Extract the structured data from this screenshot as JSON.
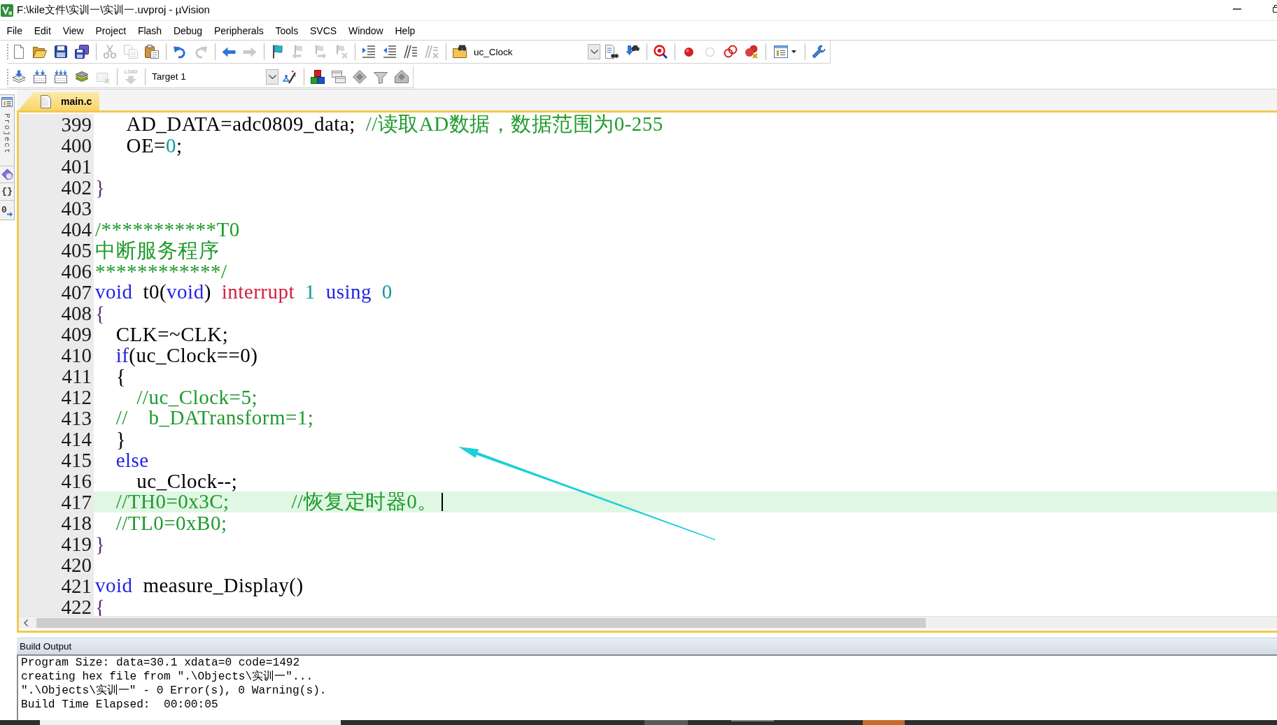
{
  "window": {
    "title": "F:\\kile文件\\实训一\\实训一.uvproj - µVision"
  },
  "menu": [
    "File",
    "Edit",
    "View",
    "Project",
    "Flash",
    "Debug",
    "Peripherals",
    "Tools",
    "SVCS",
    "Window",
    "Help"
  ],
  "toolbar_1": [
    {
      "kind": "button",
      "disabled": false
    },
    {
      "kind": "button",
      "disabled": false
    },
    {
      "kind": "button",
      "disabled": false
    },
    {
      "kind": "button",
      "disabled": false
    },
    {
      "kind": "separator"
    },
    {
      "kind": "button",
      "disabled": true
    },
    {
      "kind": "button",
      "disabled": true
    },
    {
      "kind": "button",
      "disabled": false
    },
    {
      "kind": "separator"
    },
    {
      "kind": "button",
      "disabled": false
    },
    {
      "kind": "button",
      "disabled": true
    },
    {
      "kind": "separator"
    },
    {
      "kind": "button",
      "disabled": false
    },
    {
      "kind": "button",
      "disabled": true
    },
    {
      "kind": "separator"
    },
    {
      "kind": "button",
      "disabled": false
    },
    {
      "kind": "button",
      "disabled": true
    },
    {
      "kind": "button",
      "disabled": true
    },
    {
      "kind": "button",
      "disabled": true
    },
    {
      "kind": "separator"
    },
    {
      "kind": "button",
      "disabled": false
    },
    {
      "kind": "button",
      "disabled": false
    },
    {
      "kind": "button",
      "disabled": false
    },
    {
      "kind": "button",
      "disabled": true
    },
    {
      "kind": "separator"
    },
    {
      "kind": "button",
      "disabled": false
    },
    {
      "kind": "combo",
      "value": "uc_Clock"
    },
    {
      "kind": "button",
      "disabled": false
    },
    {
      "kind": "button",
      "disabled": false
    },
    {
      "kind": "separator"
    },
    {
      "kind": "button",
      "disabled": false
    },
    {
      "kind": "separator"
    },
    {
      "kind": "button",
      "disabled": false
    },
    {
      "kind": "button",
      "disabled": true
    },
    {
      "kind": "button",
      "disabled": false
    },
    {
      "kind": "button",
      "disabled": false
    },
    {
      "kind": "separator"
    },
    {
      "kind": "button",
      "disabled": false
    },
    {
      "kind": "separator"
    },
    {
      "kind": "button",
      "disabled": false
    }
  ],
  "toolbar_2": [
    {
      "kind": "button",
      "disabled": false
    },
    {
      "kind": "button",
      "disabled": false
    },
    {
      "kind": "button",
      "disabled": false
    },
    {
      "kind": "button",
      "disabled": false
    },
    {
      "kind": "button",
      "disabled": true
    },
    {
      "kind": "separator"
    },
    {
      "kind": "button",
      "disabled": true,
      "label": "LOAD"
    },
    {
      "kind": "separator"
    },
    {
      "kind": "combo",
      "value": "Target 1"
    },
    {
      "kind": "button",
      "disabled": false
    },
    {
      "kind": "separator"
    },
    {
      "kind": "button",
      "disabled": false
    },
    {
      "kind": "button",
      "disabled": false
    },
    {
      "kind": "button",
      "disabled": false
    },
    {
      "kind": "button",
      "disabled": false
    },
    {
      "kind": "button",
      "disabled": false
    }
  ],
  "sidebar": {
    "project_tab": "Project",
    "functions_tab": "{}",
    "templates_tab": "0"
  },
  "editor_tabs": [
    {
      "label": "main.c",
      "selected": true
    }
  ],
  "code_lines": [
    {
      "number": "399",
      "current": false,
      "tokens": [
        {
          "kind": "plain",
          "text": "   AD_DATA=adc0809_data; "
        },
        {
          "kind": "comment",
          "text": "//读取AD数据，数据范围为0-255"
        }
      ]
    },
    {
      "number": "400",
      "current": false,
      "tokens": [
        {
          "kind": "plain",
          "text": "   OE="
        },
        {
          "kind": "number",
          "text": "0"
        },
        {
          "kind": "plain",
          "text": ";"
        }
      ]
    },
    {
      "number": "401",
      "current": false
    },
    {
      "number": "402",
      "current": false,
      "tokens": [
        {
          "kind": "brace",
          "text": "}"
        }
      ]
    },
    {
      "number": "403",
      "current": false
    },
    {
      "number": "404",
      "current": false,
      "tokens": [
        {
          "kind": "comment",
          "text": "/***********T0"
        }
      ]
    },
    {
      "number": "405",
      "current": false,
      "tokens": [
        {
          "kind": "comment",
          "text": "中断服务程序"
        }
      ]
    },
    {
      "number": "406",
      "current": false,
      "tokens": [
        {
          "kind": "comment",
          "text": "************/"
        }
      ]
    },
    {
      "number": "407",
      "current": false,
      "tokens": [
        {
          "kind": "keyword",
          "text": "void"
        },
        {
          "kind": "plain",
          "text": " t0("
        },
        {
          "kind": "keyword",
          "text": "void"
        },
        {
          "kind": "plain",
          "text": ") "
        },
        {
          "kind": "special",
          "text": "interrupt"
        },
        {
          "kind": "number",
          "text": " 1"
        },
        {
          "kind": "keyword",
          "text": " using"
        },
        {
          "kind": "number",
          "text": " 0"
        }
      ]
    },
    {
      "number": "408",
      "current": false,
      "tokens": [
        {
          "kind": "brace",
          "text": "{"
        }
      ]
    },
    {
      "number": "409",
      "current": false,
      "tokens": [
        {
          "kind": "plain",
          "text": "  CLK=~CLK;"
        }
      ]
    },
    {
      "number": "410",
      "current": false,
      "tokens": [
        {
          "kind": "keyword",
          "text": "  if"
        },
        {
          "kind": "plain",
          "text": "(uc_Clock==0)"
        }
      ]
    },
    {
      "number": "411",
      "current": false,
      "tokens": [
        {
          "kind": "plain",
          "text": "  {"
        }
      ]
    },
    {
      "number": "412",
      "current": false,
      "tokens": [
        {
          "kind": "comment",
          "text": "    //uc_Clock=5;"
        }
      ]
    },
    {
      "number": "413",
      "current": false,
      "tokens": [
        {
          "kind": "comment",
          "text": "  //  b_DATransform=1;"
        }
      ]
    },
    {
      "number": "414",
      "current": false,
      "tokens": [
        {
          "kind": "plain",
          "text": "  }"
        }
      ]
    },
    {
      "number": "415",
      "current": false,
      "tokens": [
        {
          "kind": "keyword",
          "text": "  else"
        }
      ]
    },
    {
      "number": "416",
      "current": false,
      "tokens": [
        {
          "kind": "plain",
          "text": "    uc_Clock--;"
        }
      ]
    },
    {
      "number": "417",
      "current": true,
      "tokens": [
        {
          "kind": "comment",
          "text": "  //TH0=0x3C;      //恢复定时器0。"
        }
      ]
    },
    {
      "number": "418",
      "current": false,
      "tokens": [
        {
          "kind": "comment",
          "text": "  //TL0=0xB0;"
        }
      ]
    },
    {
      "number": "419",
      "current": false,
      "tokens": [
        {
          "kind": "brace",
          "text": "}"
        }
      ]
    },
    {
      "number": "420",
      "current": false
    },
    {
      "number": "421",
      "current": false,
      "tokens": [
        {
          "kind": "keyword",
          "text": "void"
        },
        {
          "kind": "plain",
          "text": " measure_Display()"
        }
      ]
    },
    {
      "number": "422",
      "current": false,
      "tokens": [
        {
          "kind": "brace",
          "text": "{"
        }
      ]
    }
  ],
  "build_output": {
    "title": "Build Output",
    "lines": [
      "Program Size: data=30.1 xdata=0 code=1492",
      "creating hex file from \".\\Objects\\实训一\"...",
      "\".\\Objects\\实训一\" - 0 Error(s), 0 Warning(s).",
      "Build Time Elapsed:  00:00:05"
    ]
  }
}
